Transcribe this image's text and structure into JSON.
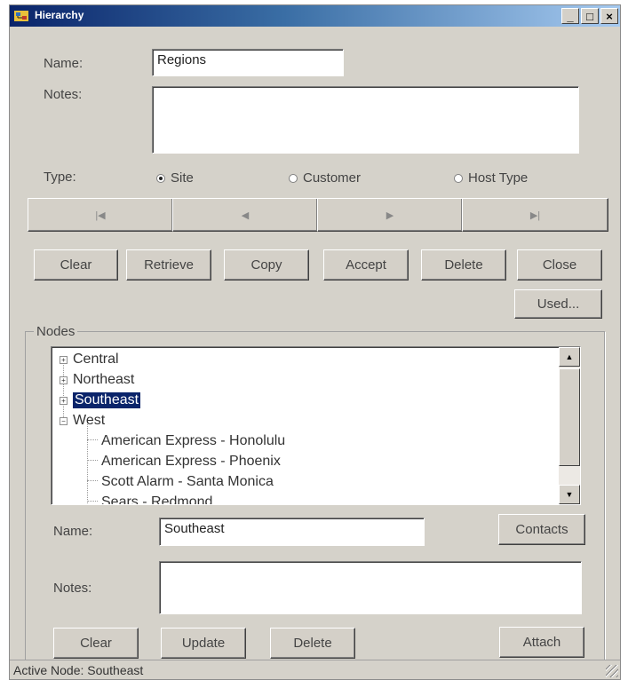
{
  "window": {
    "title": "Hierarchy",
    "minimize_glyph": "_",
    "maximize_glyph": "□",
    "close_glyph": "×"
  },
  "form": {
    "name_label": "Name:",
    "name_value": "Regions",
    "notes_label": "Notes:",
    "notes_value": "",
    "type_label": "Type:",
    "type_options": [
      "Site",
      "Customer",
      "Host Type"
    ],
    "type_selected": "Site"
  },
  "navigation": {
    "first": "|◀",
    "prev": "◀",
    "next": "▶",
    "last": "▶|"
  },
  "actions": {
    "clear": "Clear",
    "retrieve": "Retrieve",
    "copy": "Copy",
    "accept": "Accept",
    "delete": "Delete",
    "close": "Close",
    "used": "Used..."
  },
  "nodes": {
    "group_label": "Nodes",
    "tree": [
      {
        "label": "Central",
        "expander": "+"
      },
      {
        "label": "Northeast",
        "expander": "+"
      },
      {
        "label": "Southeast",
        "expander": "+",
        "selected": true
      },
      {
        "label": "West",
        "expander": "−",
        "expanded": true,
        "children": [
          "American Express - Honolulu",
          "American Express - Phoenix",
          "Scott Alarm - Santa Monica",
          "Sears - Redmond"
        ]
      }
    ],
    "name_label": "Name:",
    "name_value": "Southeast",
    "notes_label": "Notes:",
    "notes_value": "",
    "contacts": "Contacts",
    "clear": "Clear",
    "update": "Update",
    "delete": "Delete",
    "attach": "Attach"
  },
  "status_bar": {
    "text": "Active Node: Southeast"
  },
  "colors": {
    "title_gradient_start": "#0a246a",
    "window_bg": "#d5d2ca",
    "selection": "#0a246a"
  }
}
